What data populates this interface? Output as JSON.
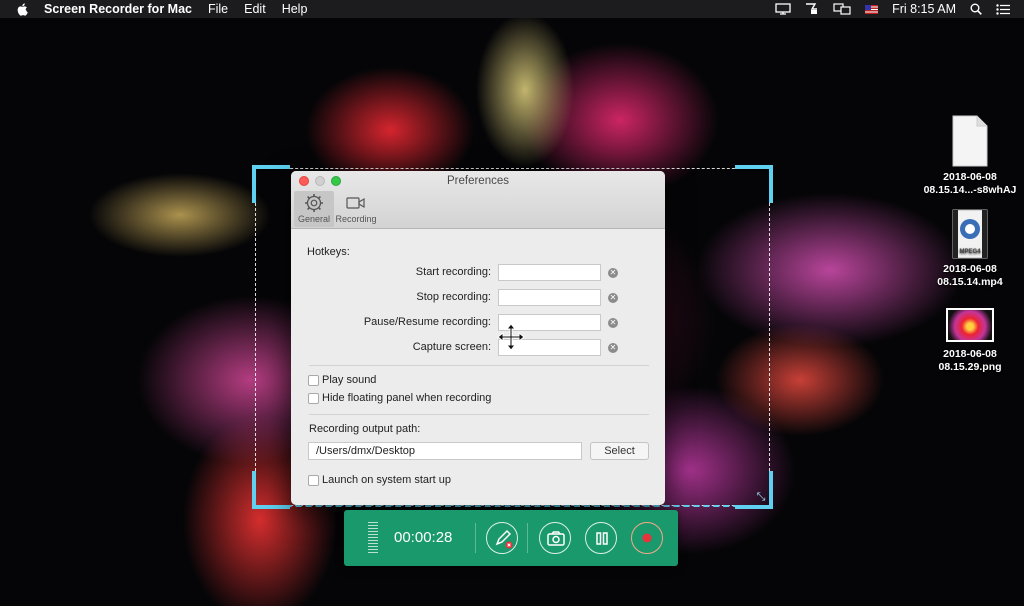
{
  "menubar": {
    "app_name": "Screen Recorder for Mac",
    "menus": [
      "File",
      "Edit",
      "Help"
    ],
    "clock": "Fri 8:15 AM"
  },
  "desktop_icons": [
    {
      "line1": "2018-06-08",
      "line2": "08.15.14...-s8whAJ",
      "type": "document-icon"
    },
    {
      "line1": "2018-06-08",
      "line2": "08.15.14.mp4",
      "type": "mpeg4-video-icon",
      "badge": "MPEG4"
    },
    {
      "line1": "2018-06-08",
      "line2": "08.15.29.png",
      "type": "image-thumbnail-icon"
    }
  ],
  "preferences": {
    "title": "Preferences",
    "tabs": [
      {
        "label": "General",
        "icon": "gear-icon",
        "active": true
      },
      {
        "label": "Recording",
        "icon": "video-camera-icon",
        "active": false
      }
    ],
    "hotkeys_heading": "Hotkeys:",
    "hotkeys": [
      {
        "label": "Start recording:",
        "value": ""
      },
      {
        "label": "Stop recording:",
        "value": ""
      },
      {
        "label": "Pause/Resume recording:",
        "value": ""
      },
      {
        "label": "Capture screen:",
        "value": ""
      }
    ],
    "options": [
      {
        "label": "Play sound",
        "checked": false
      },
      {
        "label": "Hide floating panel when recording",
        "checked": false
      }
    ],
    "output_path_label": "Recording output path:",
    "output_path": "/Users/dmx/Desktop",
    "select_label": "Select",
    "launch_label": "Launch on system start up",
    "launch_checked": false
  },
  "floating_panel": {
    "timer": "00:00:28",
    "buttons": [
      "annotate-pen-icon",
      "camera-icon",
      "pause-icon",
      "record-icon"
    ],
    "color": "#1a9a6c"
  },
  "colors": {
    "selection_accent": "#5fd0f0",
    "record": "#e8323c"
  }
}
